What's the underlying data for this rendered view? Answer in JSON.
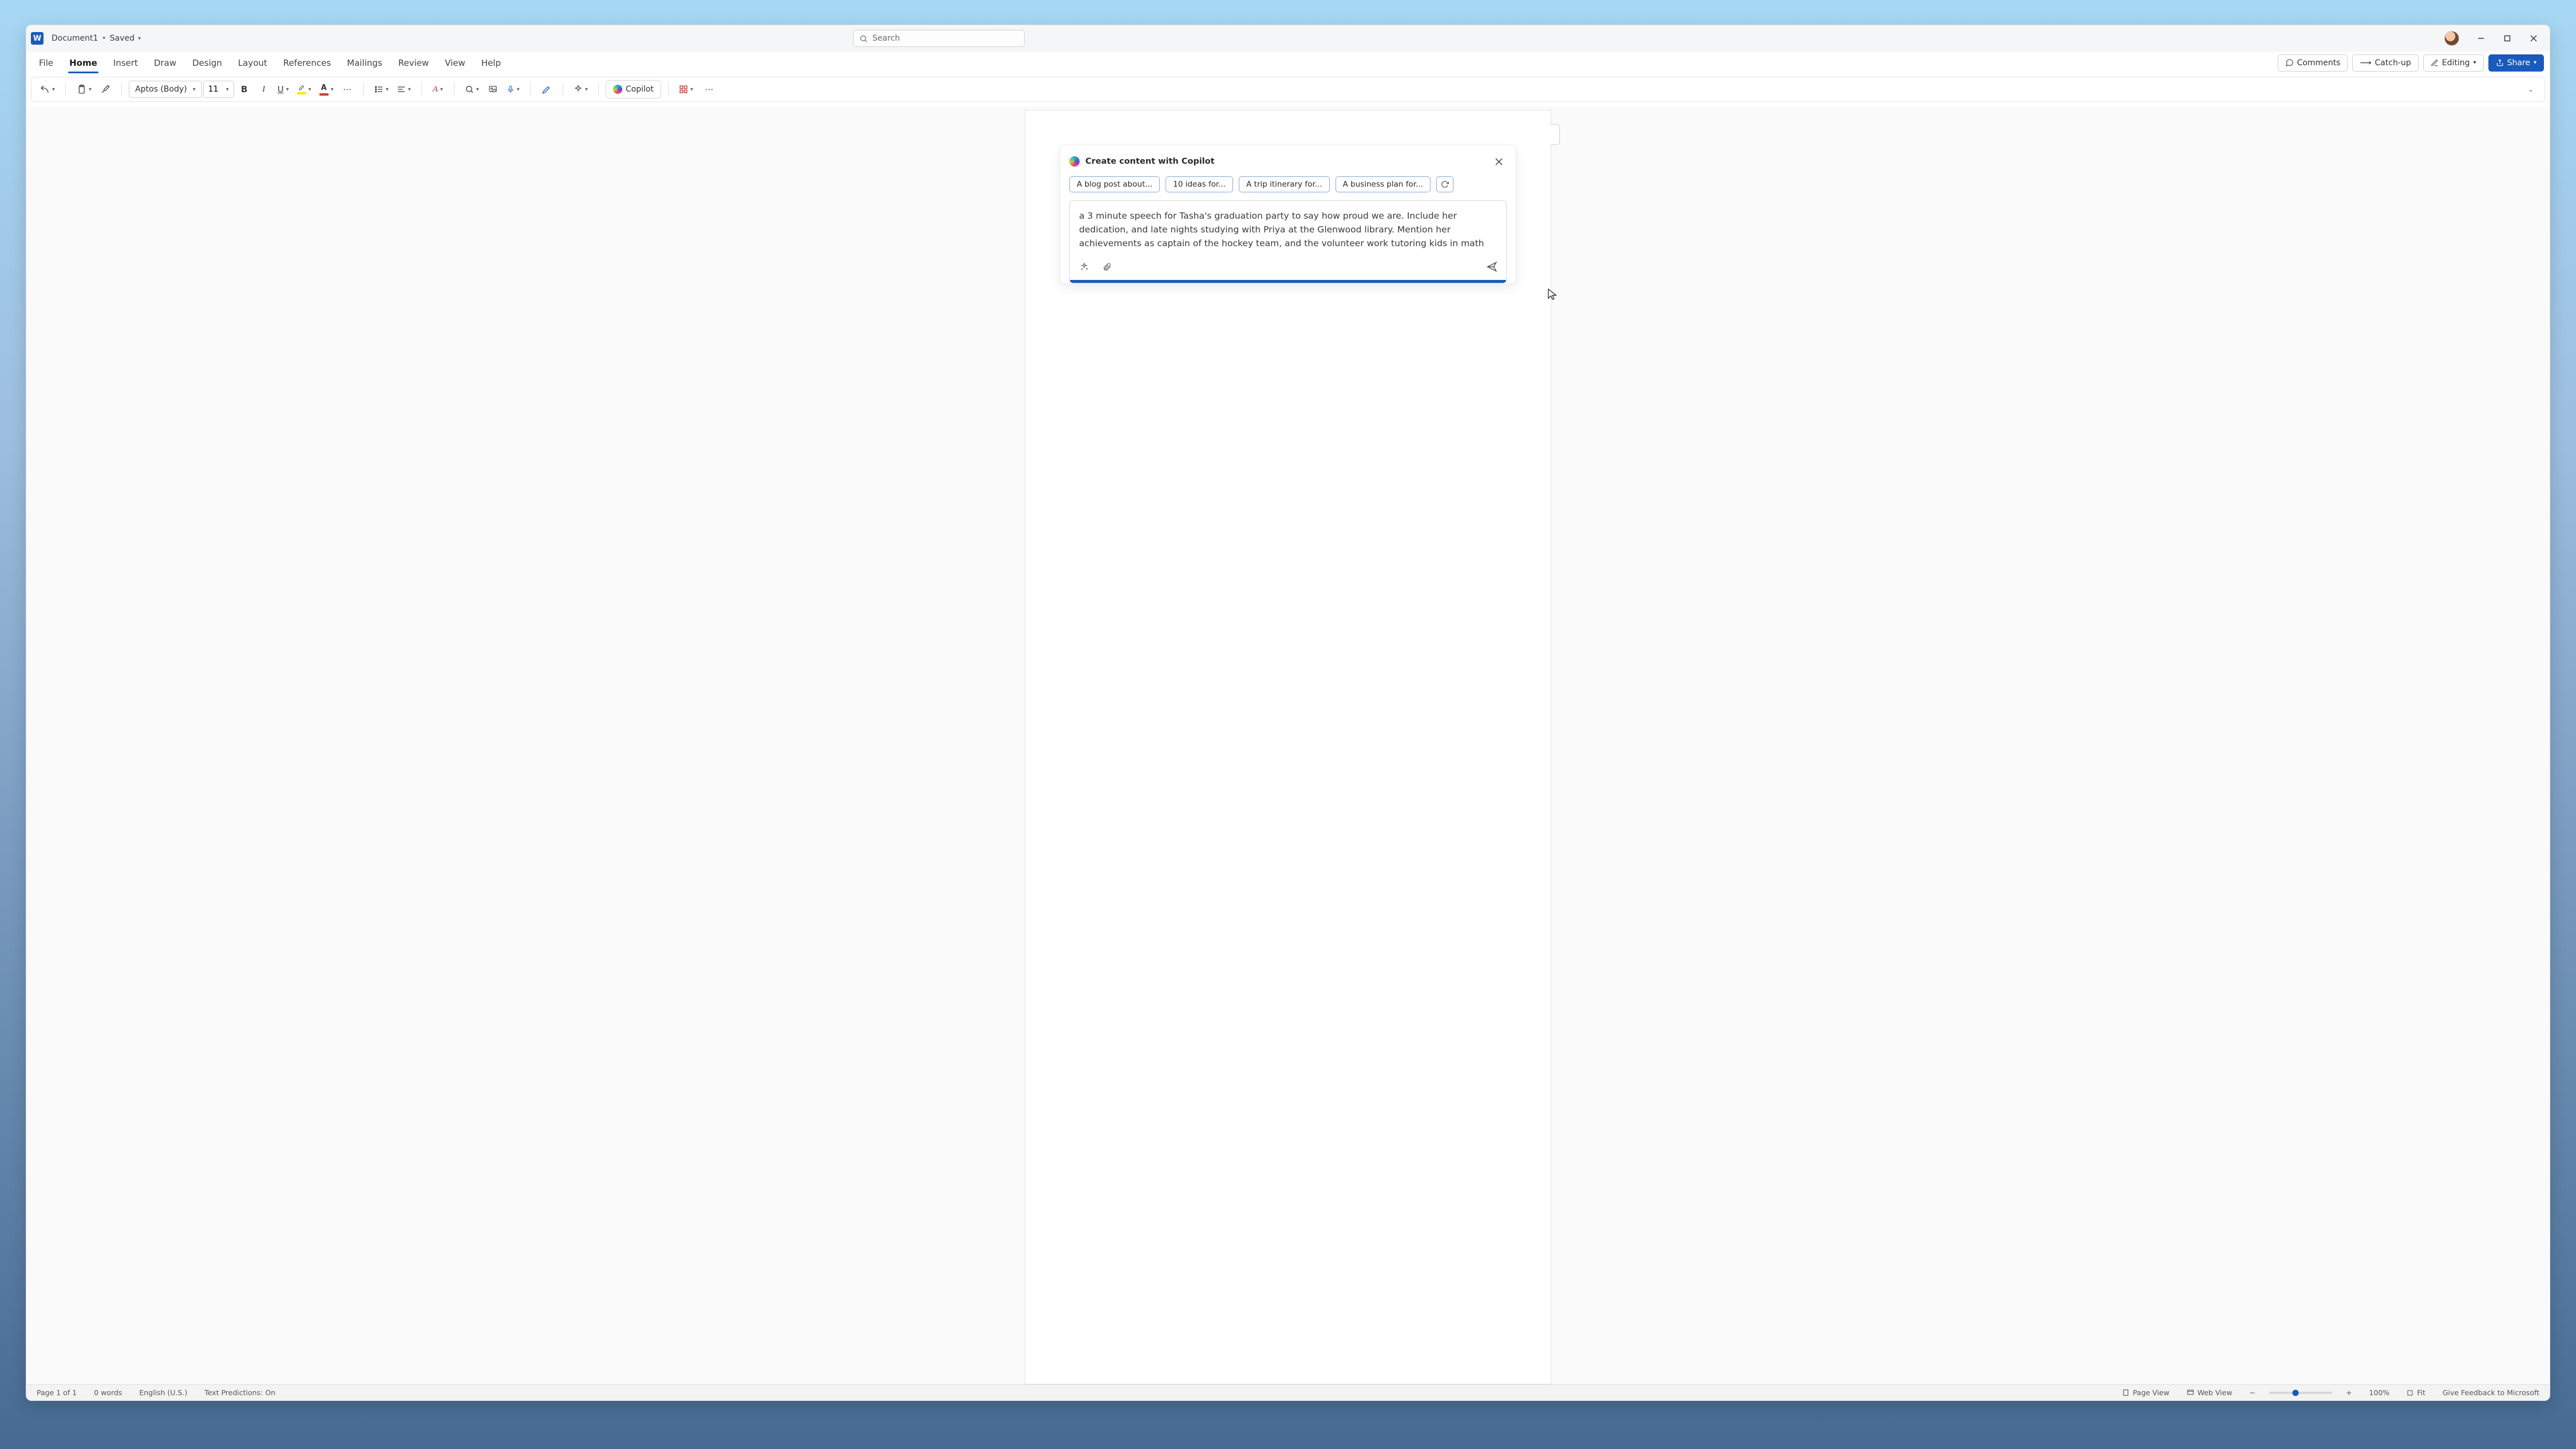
{
  "title": {
    "doc": "Document1",
    "state": "Saved"
  },
  "search": {
    "placeholder": "Search"
  },
  "tabs": {
    "items": [
      "File",
      "Home",
      "Insert",
      "Draw",
      "Design",
      "Layout",
      "References",
      "Mailings",
      "Review",
      "View",
      "Help"
    ],
    "active_index": 1
  },
  "tab_actions": {
    "comments": "Comments",
    "catchup": "Catch-up",
    "editing": "Editing",
    "share": "Share"
  },
  "ribbon": {
    "font_name": "Aptos (Body)",
    "font_size": "11",
    "copilot": "Copilot"
  },
  "copilot": {
    "title": "Create content with Copilot",
    "suggestions": [
      "A blog post about...",
      "10 ideas for...",
      "A trip itinerary for...",
      "A business plan for..."
    ],
    "prompt": "a 3 minute speech for Tasha's graduation party to say how proud we are. Include her dedication, and late nights studying with Priya at the Glenwood library. Mention her achievements as captain of the hockey team, and the volunteer work tutoring kids in math"
  },
  "status": {
    "page": "Page 1 of 1",
    "words": "0 words",
    "lang": "English (U.S.)",
    "pred": "Text Predictions: On",
    "pageview": "Page View",
    "webview": "Web View",
    "zoom": "100%",
    "fit": "Fit",
    "feedback": "Give Feedback to Microsoft"
  }
}
